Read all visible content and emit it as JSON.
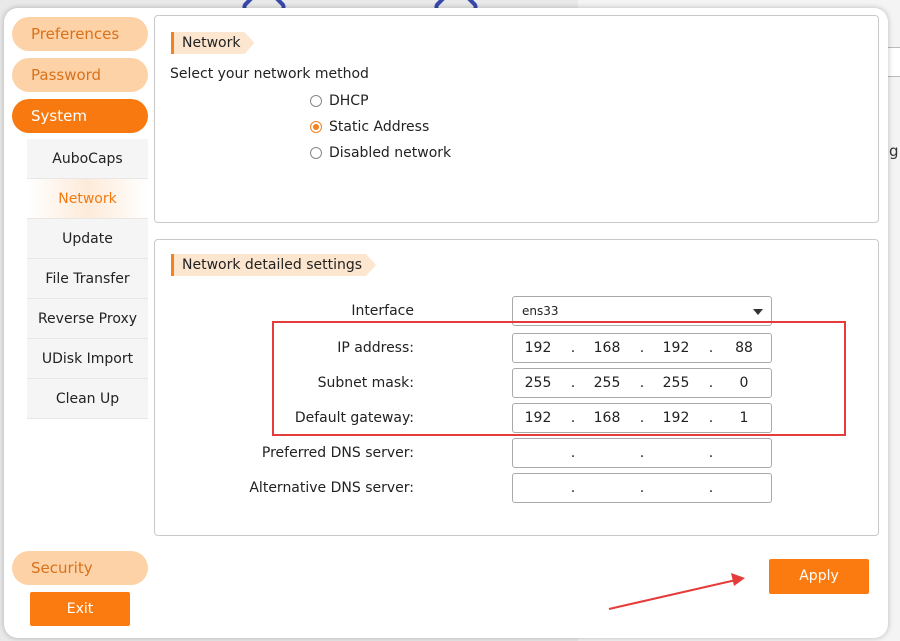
{
  "sidebar": {
    "top_items": [
      "Preferences",
      "Password",
      "System"
    ],
    "sub_items": [
      "AuboCaps",
      "Network",
      "Update",
      "File Transfer",
      "Reverse Proxy",
      "UDisk Import",
      "Clean Up"
    ],
    "security_label": "Security",
    "exit_label": "Exit"
  },
  "network": {
    "section_title": "Network",
    "method_prompt": "Select your network method",
    "options": [
      "DHCP",
      "Static Address",
      "Disabled network"
    ],
    "selected_option": "Static Address"
  },
  "detail": {
    "section_title": "Network detailed settings",
    "interface_label": "Interface",
    "interface_value": "ens33",
    "ip_label": "IP address:",
    "ip": [
      "192",
      "168",
      "192",
      "88"
    ],
    "subnet_label": "Subnet mask:",
    "subnet": [
      "255",
      "255",
      "255",
      "0"
    ],
    "gateway_label": "Default gateway:",
    "gateway": [
      "192",
      "168",
      "192",
      "1"
    ],
    "dns1_label": "Preferred DNS server:",
    "dns1": [
      "",
      "",
      "",
      ""
    ],
    "dns2_label": "Alternative DNS server:",
    "dns2": [
      "",
      "",
      "",
      ""
    ]
  },
  "apply_label": "Apply",
  "colors": {
    "accent": "#f87910",
    "accent_light": "#fdd2a6",
    "annotation": "#e63b3b"
  }
}
